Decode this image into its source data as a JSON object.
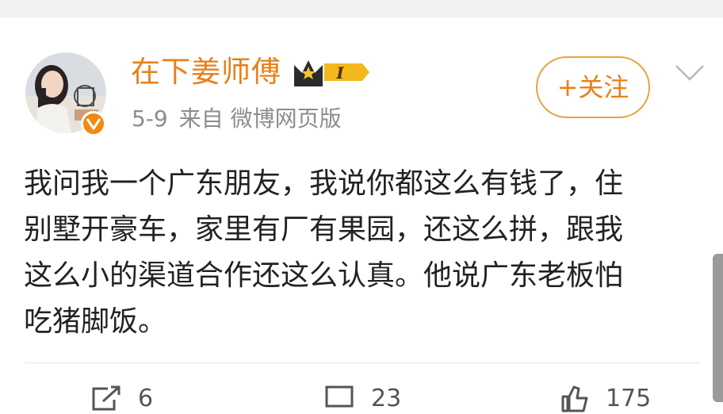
{
  "post": {
    "username": "在下姜师傅",
    "vip_level": "I",
    "date": "5-9",
    "source": "来自 微博网页版",
    "follow_label": "+关注",
    "text_lines": [
      "我问我一个广东朋友，我说你都这么有钱了，住",
      "别墅开豪车，家里有厂有果园，还这么拼，跟我",
      "这么小的渠道合作还这么认真。他说广东老板怕",
      "吃猪脚饭。"
    ]
  },
  "actions": {
    "repost_count": "6",
    "comment_count": "23",
    "like_count": "175"
  },
  "colors": {
    "accent": "#e8801a",
    "badge": "#f08a10",
    "meta": "#8c8c8c"
  }
}
